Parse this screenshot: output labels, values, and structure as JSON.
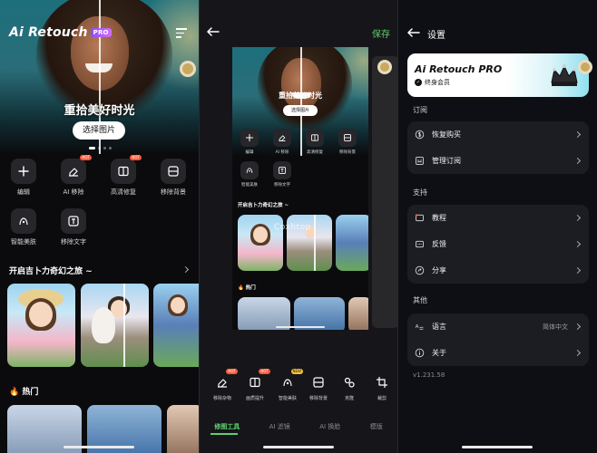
{
  "colors": {
    "accent_green": "#5ed06b",
    "hot_red": "#ff5b3a",
    "pro_purple": "#a25bff",
    "card_bg": "#1c1d22"
  },
  "panel1": {
    "logo": "Ai Retouch",
    "logo_badge": "PRO",
    "hero_title": "重拾美好时光",
    "select_button": "选择图片",
    "tools": [
      {
        "label": "编辑",
        "icon": "plus-icon",
        "tag": ""
      },
      {
        "label": "AI 移除",
        "icon": "eraser-icon",
        "tag": "HOT"
      },
      {
        "label": "高清修复",
        "icon": "enhance-icon",
        "tag": "HOT"
      },
      {
        "label": "移除背景",
        "icon": "remove-bg-icon",
        "tag": ""
      },
      {
        "label": "智能美肤",
        "icon": "face-icon",
        "tag": ""
      },
      {
        "label": "移除文字",
        "icon": "text-remove-icon",
        "tag": ""
      }
    ],
    "section_anime": "开启吉卜力奇幻之旅 ~",
    "section_hot": "🔥 热门"
  },
  "panel2": {
    "save": "保存",
    "preview": {
      "hero_title": "重拾美好时光",
      "select_button": "选择图片",
      "tools": [
        {
          "label": "编辑",
          "icon": "plus-icon"
        },
        {
          "label": "AI 移除",
          "icon": "eraser-icon"
        },
        {
          "label": "高清修复",
          "icon": "enhance-icon"
        },
        {
          "label": "移除背景",
          "icon": "remove-bg-icon"
        },
        {
          "label": "智能美肤",
          "icon": "face-icon"
        },
        {
          "label": "移除文字",
          "icon": "text-remove-icon"
        }
      ],
      "section_anime": "开启吉卜力奇幻之旅 ~",
      "section_hot": "🔥 热门"
    },
    "watermark": "Coxhtop",
    "toolbar": [
      {
        "label": "移除杂物",
        "icon": "eraser-icon",
        "tag": "HOT"
      },
      {
        "label": "画质提升",
        "icon": "enhance-icon",
        "tag": "HOT"
      },
      {
        "label": "智能美肤",
        "icon": "face-icon",
        "tag": "NEW"
      },
      {
        "label": "移除背景",
        "icon": "remove-bg-icon",
        "tag": ""
      },
      {
        "label": "克隆",
        "icon": "clone-icon",
        "tag": ""
      },
      {
        "label": "裁剪",
        "icon": "crop-icon",
        "tag": ""
      }
    ],
    "tabs": [
      "修图工具",
      "AI 滤镜",
      "AI 换脸",
      "模版"
    ]
  },
  "panel3": {
    "title": "设置",
    "pro_title": "Ai Retouch PRO",
    "pro_subtitle": "终身会员",
    "groups": [
      {
        "label": "订阅",
        "rows": [
          {
            "text": "恢复购买",
            "icon": "dollar-icon",
            "value": ""
          },
          {
            "text": "管理订阅",
            "icon": "bookmark-icon",
            "value": ""
          }
        ]
      },
      {
        "label": "支持",
        "rows": [
          {
            "text": "教程",
            "icon": "tutorial-icon",
            "value": ""
          },
          {
            "text": "反馈",
            "icon": "feedback-icon",
            "value": ""
          },
          {
            "text": "分享",
            "icon": "share-icon",
            "value": ""
          }
        ]
      },
      {
        "label": "其他",
        "rows": [
          {
            "text": "语言",
            "icon": "language-icon",
            "value": "简体中文"
          },
          {
            "text": "关于",
            "icon": "info-icon",
            "value": ""
          }
        ]
      }
    ],
    "version": "v1.231.58"
  }
}
